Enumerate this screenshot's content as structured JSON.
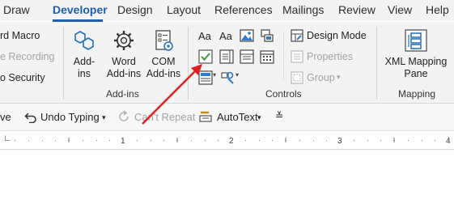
{
  "tabs": [
    {
      "label": "Draw",
      "active": false
    },
    {
      "label": "Developer",
      "active": true
    },
    {
      "label": "Design",
      "active": false
    },
    {
      "label": "Layout",
      "active": false
    },
    {
      "label": "References",
      "active": false
    },
    {
      "label": "Mailings",
      "active": false
    },
    {
      "label": "Review",
      "active": false
    },
    {
      "label": "View",
      "active": false
    },
    {
      "label": "Help",
      "active": false
    }
  ],
  "code_group": {
    "record_macro": "rd Macro",
    "pause_recording": "e Recording",
    "macro_security": "o Security"
  },
  "addins_group": {
    "label": "Add-ins",
    "addins_line1": "Add-",
    "addins_line2": "ins",
    "word_addins_line1": "Word",
    "word_addins_line2": "Add-ins",
    "com_addins_line1": "COM",
    "com_addins_line2": "Add-ins"
  },
  "controls_group": {
    "label": "Controls",
    "rich_text_glyph": "Aa",
    "plain_text_glyph": "Aa",
    "design_mode": "Design Mode",
    "properties": "Properties",
    "group": "Group"
  },
  "mapping_group": {
    "label": "Mapping",
    "xml_line1": "XML Mapping",
    "xml_line2": "Pane"
  },
  "quick_access": {
    "save_fragment": "ve",
    "undo_typing": "Undo Typing",
    "cant_repeat": "Can't Repeat",
    "autotext": "AutoText"
  },
  "ruler": {
    "numbers": [
      "1",
      "2",
      "3",
      "4",
      "5"
    ]
  },
  "colors": {
    "accent": "#1e5fa8",
    "arrow": "#e02020",
    "checkbox": "#3a9a3a"
  }
}
